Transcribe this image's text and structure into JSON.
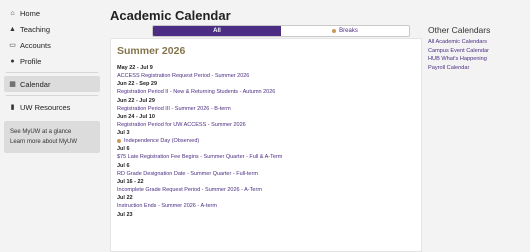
{
  "sidebar": {
    "items": [
      {
        "label": "Home",
        "icon": "home-icon"
      },
      {
        "label": "Teaching",
        "icon": "graduation-cap-icon"
      },
      {
        "label": "Accounts",
        "icon": "credit-card-icon"
      },
      {
        "label": "Profile",
        "icon": "user-icon"
      },
      {
        "label": "Calendar",
        "icon": "calendar-icon"
      },
      {
        "label": "UW Resources",
        "icon": "bookmark-icon"
      }
    ],
    "glance_text": "See MyUW at a glance",
    "learn_more": "Learn more about MyUW"
  },
  "main": {
    "title": "Academic Calendar",
    "filter": {
      "all": "All",
      "breaks": "Breaks"
    },
    "season": "Summer 2026",
    "events": [
      {
        "date": "May 22 - Jul 9",
        "title": "ACCESS Registration Request Period - Summer 2026",
        "dot": false
      },
      {
        "date": "Jun 22 - Sep 29",
        "title": "Registration Period II - New & Returning Students - Autumn 2026",
        "dot": false
      },
      {
        "date": "Jun 22 - Jul 29",
        "title": "Registration Period III - Summer 2026 - B-term",
        "dot": false
      },
      {
        "date": "Jun 24 - Jul 10",
        "title": "Registration Period for UW ACCESS - Summer 2026",
        "dot": false
      },
      {
        "date": "Jul 3",
        "title": "Independence Day (Observed)",
        "dot": true
      },
      {
        "date": "Jul 6",
        "title": "$75 Late Registration Fee Begins - Summer Quarter - Full & A-Term",
        "dot": false
      },
      {
        "date": "Jul 6",
        "title": "RD Grade Designation Date - Summer Quarter - Full-term",
        "dot": false
      },
      {
        "date": "Jul 16 - 22",
        "title": "Incomplete Grade Request Period - Summer 2026 - A-Term",
        "dot": false
      },
      {
        "date": "Jul 22",
        "title": "Instruction Ends - Summer 2026 - A-term",
        "dot": false
      },
      {
        "date": "Jul 23",
        "title": "",
        "dot": false
      }
    ]
  },
  "right": {
    "heading": "Other Calendars",
    "links": [
      "All Academic Calendars",
      "Campus Event Calendar",
      "HUB What's Happening",
      "Payroll Calendar"
    ]
  },
  "colors": {
    "accent": "#4b2e83",
    "gold": "#85754d",
    "break_dot": "#c79a5b"
  }
}
